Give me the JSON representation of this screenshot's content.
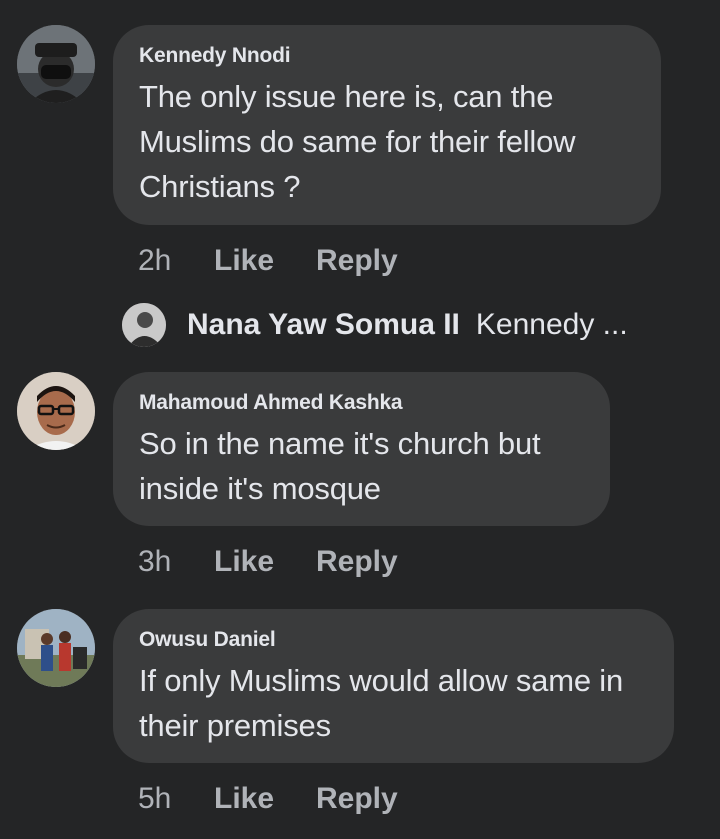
{
  "comments": [
    {
      "author": "Kennedy Nnodi",
      "text": "The only issue here is, can the Muslims do same for their fellow Christians ?",
      "time": "2h",
      "like_label": "Like",
      "reply_label": "Reply"
    },
    {
      "author": "Mahamoud Ahmed Kashka",
      "text": "So in the name it's church but inside it's mosque",
      "time": "3h",
      "like_label": "Like",
      "reply_label": "Reply"
    },
    {
      "author": "Owusu Daniel",
      "text": "If only Muslims would allow same in their premises",
      "time": "5h",
      "like_label": "Like",
      "reply_label": "Reply"
    }
  ],
  "reply_preview": {
    "author": "Nana Yaw Somua II",
    "text": "Kennedy ..."
  },
  "colors": {
    "background": "#242526",
    "bubble": "#3a3b3c",
    "primary_text": "#e4e6eb",
    "secondary_text": "#b0b3b8"
  }
}
